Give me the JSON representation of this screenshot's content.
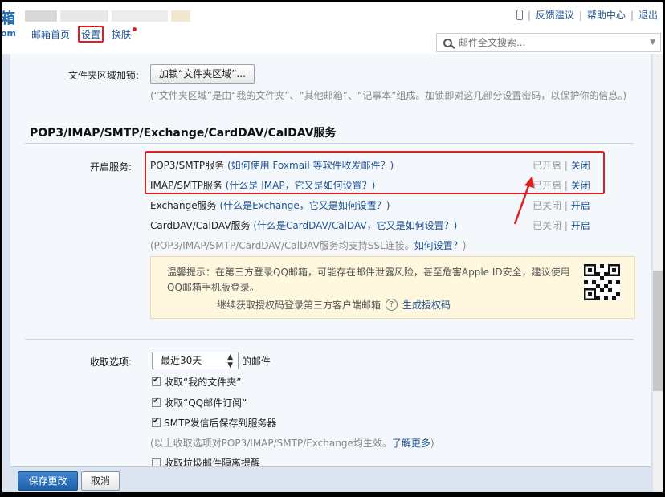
{
  "header": {
    "logo_glyph": "箱",
    "logo_suffix": "om",
    "nav": {
      "home": "邮箱首页",
      "settings": "设置",
      "skin": "换肤"
    },
    "toplinks": {
      "feedback": "反馈建议",
      "help": "帮助中心",
      "logout": "退出"
    },
    "search": {
      "placeholder": "邮件全文搜索..."
    }
  },
  "folder_lock": {
    "label": "文件夹区域加锁:",
    "button": "加锁“文件夹区域”...",
    "note": "(“文件夹区域”是由“我的文件夹”、“其他邮箱”、“记事本”组成。加锁即对这几部分设置密码，以保护你的信息。)"
  },
  "section_title": "POP3/IMAP/SMTP/Exchange/CardDAV/CalDAV服务",
  "services": {
    "label": "开启服务:",
    "items": [
      {
        "name": "POP3/SMTP服务",
        "help": "(如何使用 Foxmail 等软件收发邮件？)",
        "status": "已开启",
        "action": "关闭"
      },
      {
        "name": "IMAP/SMTP服务",
        "help": "(什么是 IMAP，它又是如何设置？)",
        "status": "已开启",
        "action": "关闭"
      },
      {
        "name": "Exchange服务",
        "help": "(什么是Exchange，它又是如何设置？)",
        "status": "已关闭",
        "action": "开启"
      },
      {
        "name": "CardDAV/CalDAV服务",
        "help": "(什么是CardDAV/CalDAV，它又是如何设置？)",
        "status": "已关闭",
        "action": "开启"
      }
    ],
    "ssl_note": "(POP3/IMAP/SMTP/CardDAV/CalDAV服务均支持SSL连接。",
    "ssl_link": "如何设置？",
    "ssl_close": ")"
  },
  "tip": {
    "text": "温馨提示：在第三方登录QQ邮箱，可能存在邮件泄露风险，甚至危害Apple ID安全，建议使用QQ邮箱手机版登录。",
    "line2": "继续获取授权码登录第三方客户端邮箱",
    "help": "?",
    "link": "生成授权码"
  },
  "fetch": {
    "label": "收取选项:",
    "select_value": "最近30天",
    "select_suffix": "的邮件",
    "options": [
      {
        "label": "收取“我的文件夹”",
        "checked": true
      },
      {
        "label": "收取“QQ邮件订阅”",
        "checked": true
      },
      {
        "label": "SMTP发信后保存到服务器",
        "checked": true
      }
    ],
    "note": "(以上收取选项对POP3/IMAP/SMTP/Exchange均生效。",
    "note_link": "了解更多",
    "note_close": ")",
    "spam": {
      "label": "收取垃圾邮件隔离提醒",
      "checked": false
    }
  },
  "footer": {
    "save": "保存更改",
    "cancel": "取消"
  },
  "colors": {
    "link": "#1e5494",
    "highlight": "#e02020",
    "primary": "#1f5fa8"
  }
}
